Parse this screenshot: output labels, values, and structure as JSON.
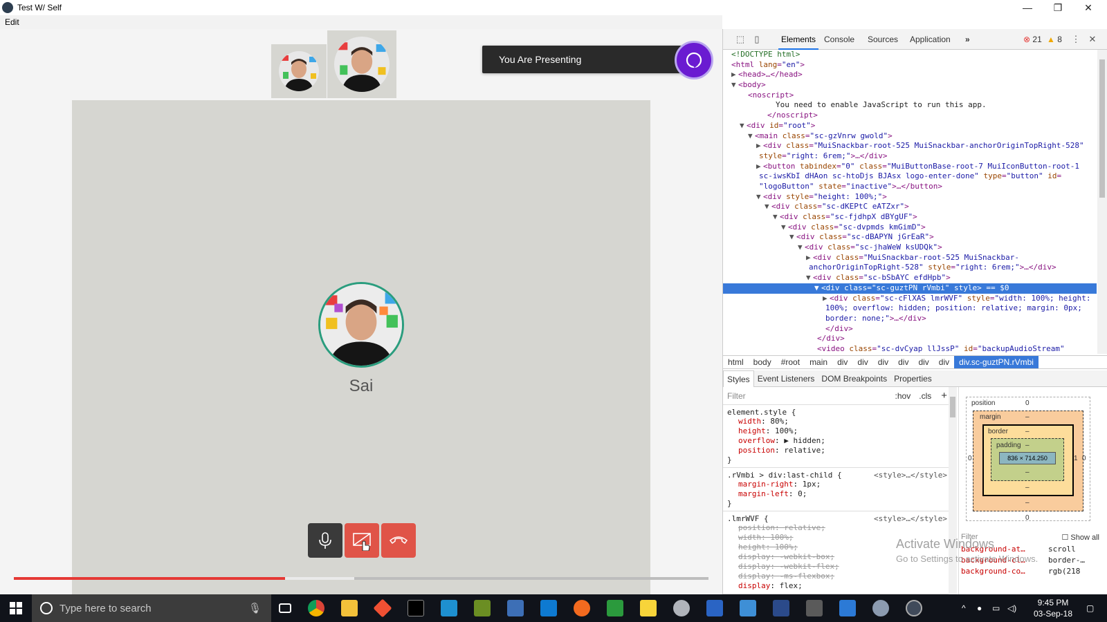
{
  "window": {
    "title": "Test W/ Self",
    "menu_edit": "Edit"
  },
  "call": {
    "presenting_text": "You Are Presenting",
    "participant_name": "Sai",
    "progress_fraction": 0.39,
    "buffered_fraction": 0.49
  },
  "devtools": {
    "tabs": [
      "Elements",
      "Console",
      "Sources",
      "Application"
    ],
    "more": "»",
    "errors": "21",
    "warnings": "8",
    "breadcrumbs": [
      "html",
      "body",
      "#root",
      "main",
      "div",
      "div",
      "div",
      "div",
      "div",
      "div",
      "div.sc-guztPN.rVmbi"
    ],
    "subtabs": [
      "Styles",
      "Event Listeners",
      "DOM Breakpoints",
      "Properties"
    ],
    "filter_placeholder": "Filter",
    "hov": ":hov",
    "cls": ".cls",
    "plus": "+",
    "box": {
      "position": "position",
      "position_val": "0",
      "margin": "margin",
      "border": "border",
      "padding": "padding",
      "dash": "–",
      "content": "836 × 714.250",
      "left_val": "0",
      "right_val": "1",
      "right_val2": "0",
      "bottom_val": "0"
    },
    "computed_filter": "Filter",
    "show_all": "Show all",
    "computed": [
      {
        "name": "background-at…",
        "value": "scroll"
      },
      {
        "name": "background-cl…",
        "value": "border-…"
      },
      {
        "name": "background-co…",
        "value": "rgb(218"
      }
    ]
  },
  "activate": {
    "line1": "Activate Windows",
    "line2": "Go to Settings to activate Windows."
  },
  "taskbar": {
    "search_placeholder": "Type here to search",
    "time": "9:45 PM",
    "date": "03-Sep-18"
  },
  "colors": {
    "accent_red": "#e53935",
    "devtools_select": "#3879d9",
    "logo_purple": "#6a1bd1"
  }
}
